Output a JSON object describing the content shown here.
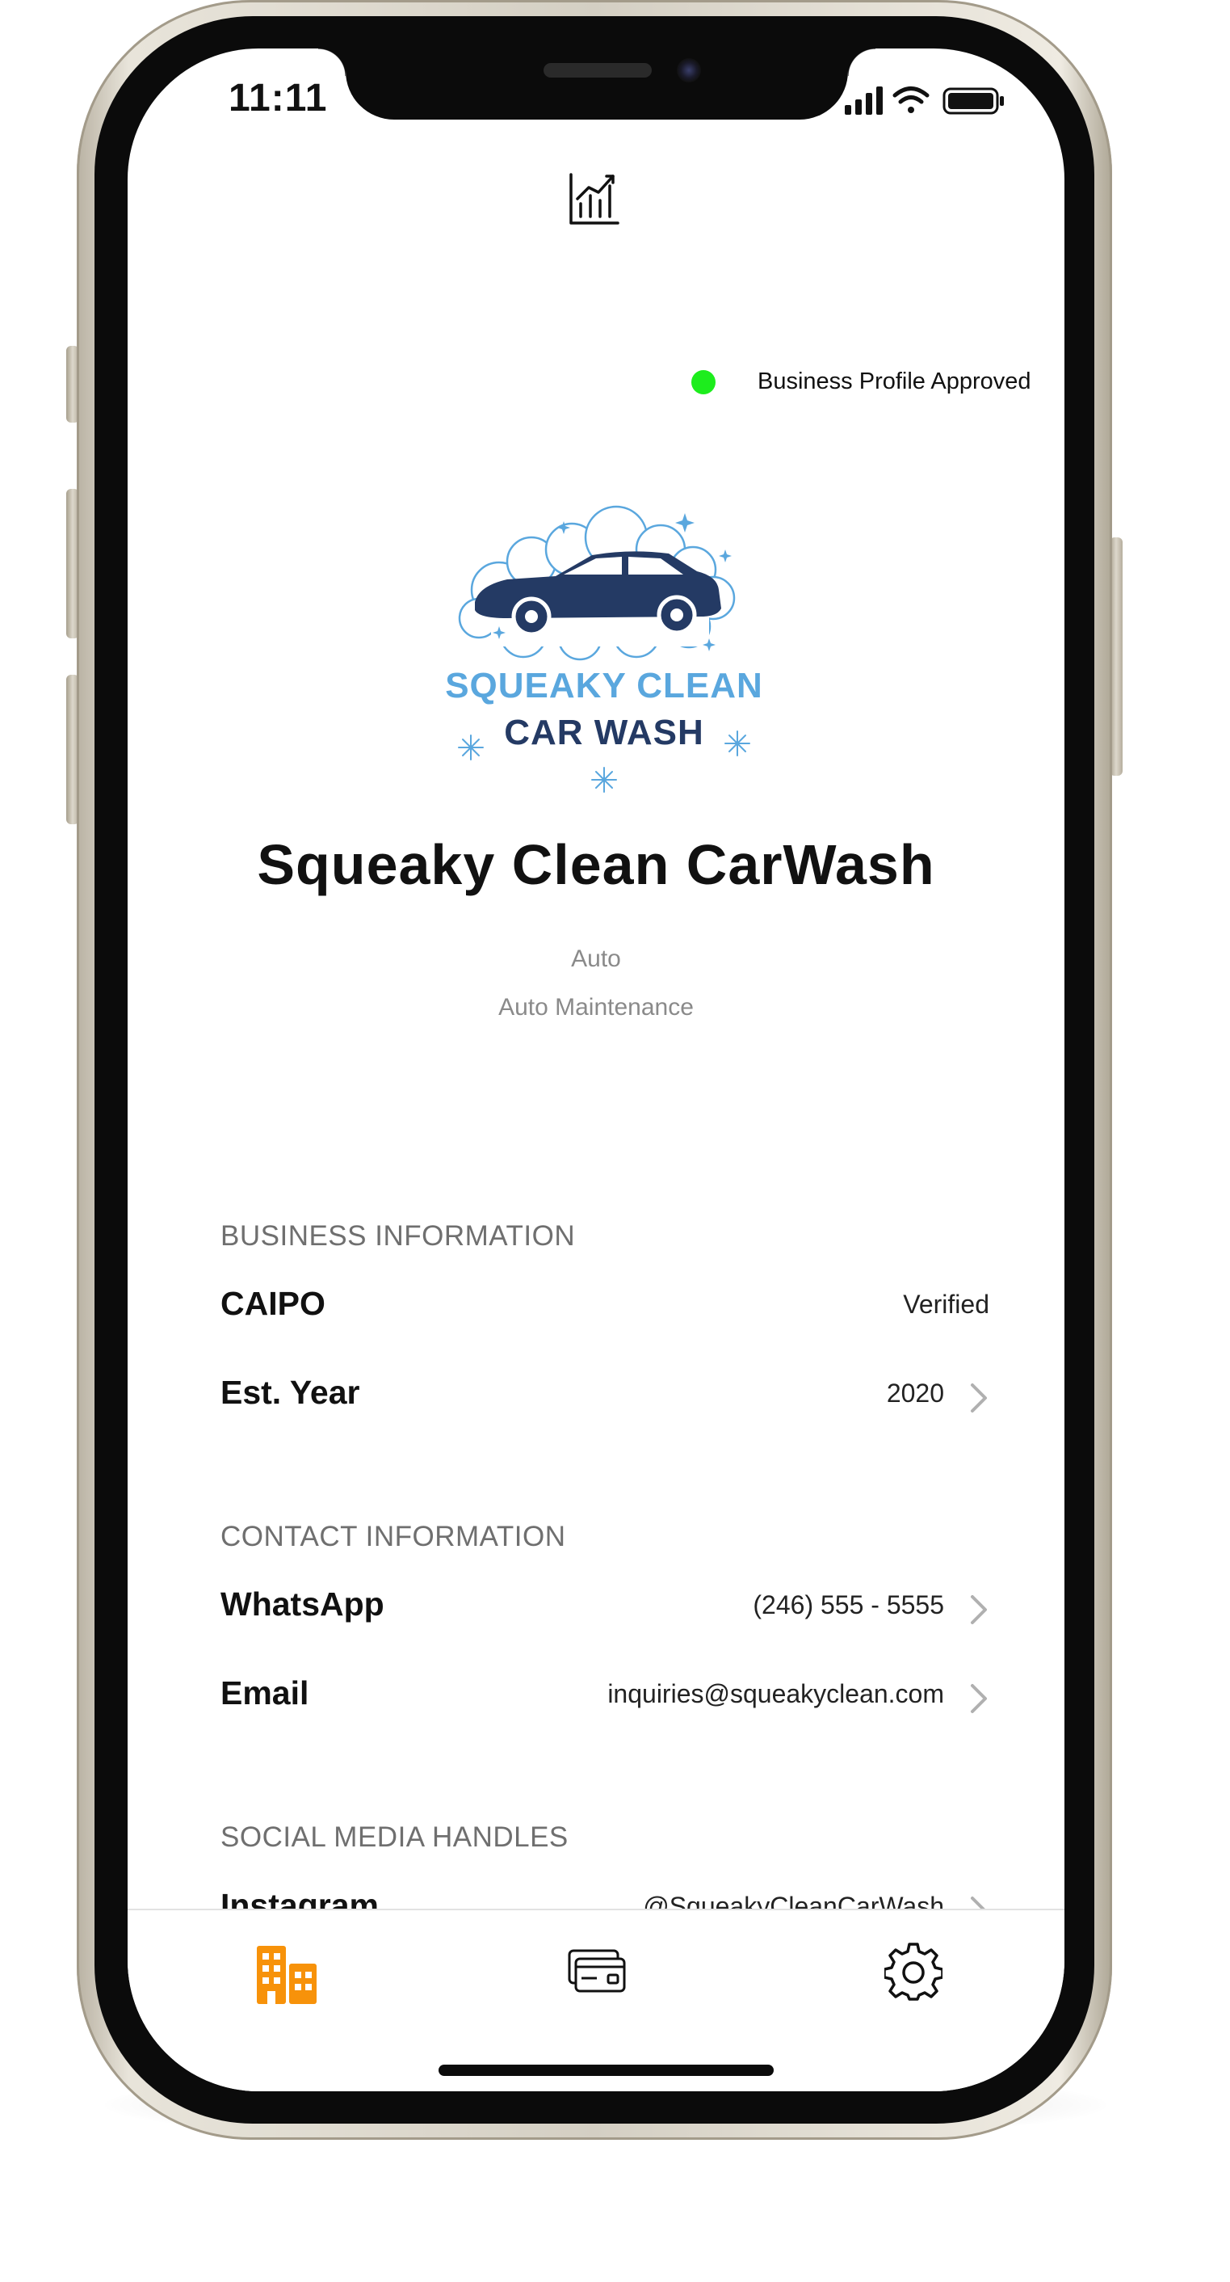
{
  "status_bar": {
    "time": "11:11"
  },
  "header": {
    "analytics_icon": "analytics-chart-icon",
    "approval_status": "Business Profile Approved",
    "approval_color": "#1ded1d"
  },
  "logo": {
    "line1": "SQUEAKY CLEAN",
    "line2": "CAR WASH",
    "line1_color": "#4d9bd6",
    "line2_color": "#243a64"
  },
  "profile": {
    "name": "Squeaky Clean CarWash",
    "category": "Auto",
    "subcategory": "Auto Maintenance"
  },
  "business_info": {
    "header": "BUSINESS INFORMATION",
    "rows": [
      {
        "label": "CAIPO",
        "value": "Verified"
      },
      {
        "label": "Est. Year",
        "value": "2020"
      }
    ]
  },
  "contact_info": {
    "header": "CONTACT INFORMATION",
    "rows": [
      {
        "label": "WhatsApp",
        "value": "(246) 555 - 5555"
      },
      {
        "label": "Email",
        "value": "inquiries@squeakyclean.com"
      }
    ]
  },
  "social_media": {
    "header": "SOCIAL MEDIA HANDLES",
    "rows": [
      {
        "label": "Instagram",
        "value": "@SqueakyCleanCarWash"
      }
    ]
  },
  "tabbar": {
    "tabs": [
      {
        "icon": "business-buildings-icon",
        "active": true
      },
      {
        "icon": "cards-icon",
        "active": false
      },
      {
        "icon": "gear-icon",
        "active": false
      }
    ],
    "active_color": "#f7920a"
  }
}
